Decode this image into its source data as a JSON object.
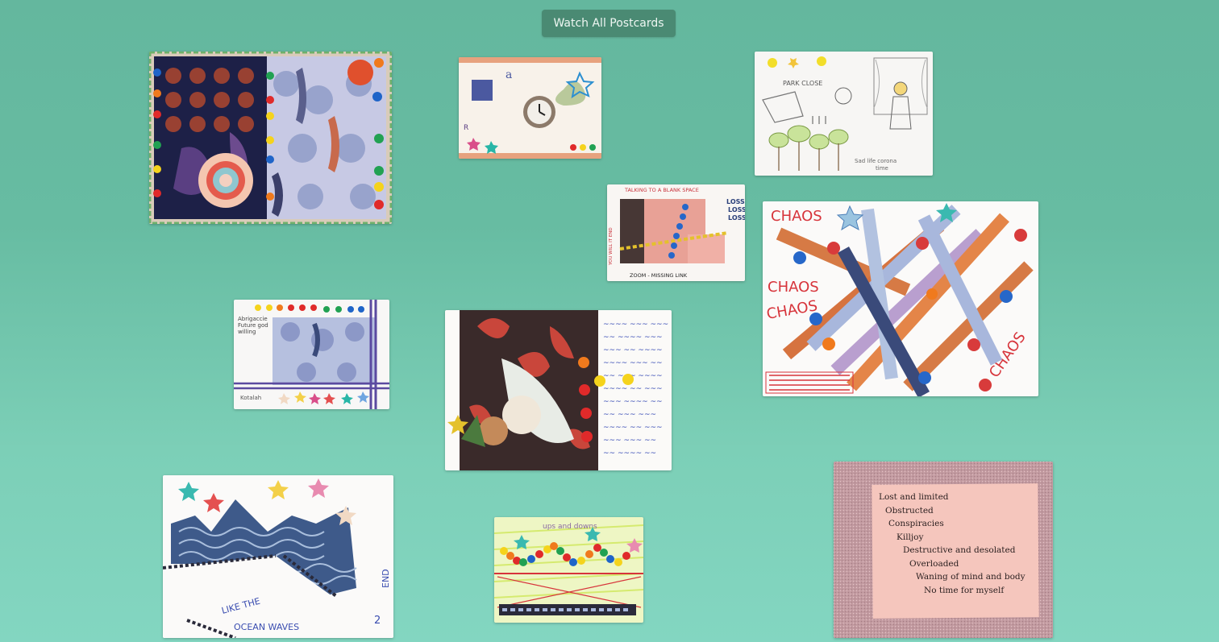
{
  "header": {
    "watch_label": "Watch All Postcards"
  },
  "postcards": [
    {
      "id": "koi-floral"
    },
    {
      "id": "collage-clock"
    },
    {
      "id": "park-close"
    },
    {
      "id": "blank-space"
    },
    {
      "id": "chaos"
    },
    {
      "id": "abrigaccie"
    },
    {
      "id": "arabic-script"
    },
    {
      "id": "ocean-waves"
    },
    {
      "id": "ups-downs"
    },
    {
      "id": "lockdown"
    }
  ],
  "text": {
    "park_close": "PARK CLOSE",
    "park_sig": "Sad life corona",
    "park_sig2": "time",
    "blank_title": "TALKING TO A BLANK SPACE",
    "blank_loss1": "LOSS",
    "blank_loss2": "LOSS",
    "blank_loss3": "LOSS",
    "blank_bottom": "ZOOM - MISSING LINK",
    "blank_side": "YOU WILL IT END",
    "chaos1": "CHAOS",
    "chaos2": "CHAOS",
    "chaos3": "CHAOS",
    "chaos4": "CHAOS",
    "abri1": "Abrigaccie",
    "abri2": "Future god",
    "abri3": "willing",
    "abri_sig": "Kotalah",
    "ocean1": "LIKE THE",
    "ocean2": "OCEAN WAVES",
    "ocean_end": "END",
    "ocean_num": "2",
    "ups": "ups and downs",
    "lock": [
      "Lost and limited",
      "Obstructed",
      "Conspiracies",
      "Killjoy",
      "Destructive and desolated",
      "Overloaded",
      "Waning of mind and body",
      "No time for myself"
    ]
  }
}
